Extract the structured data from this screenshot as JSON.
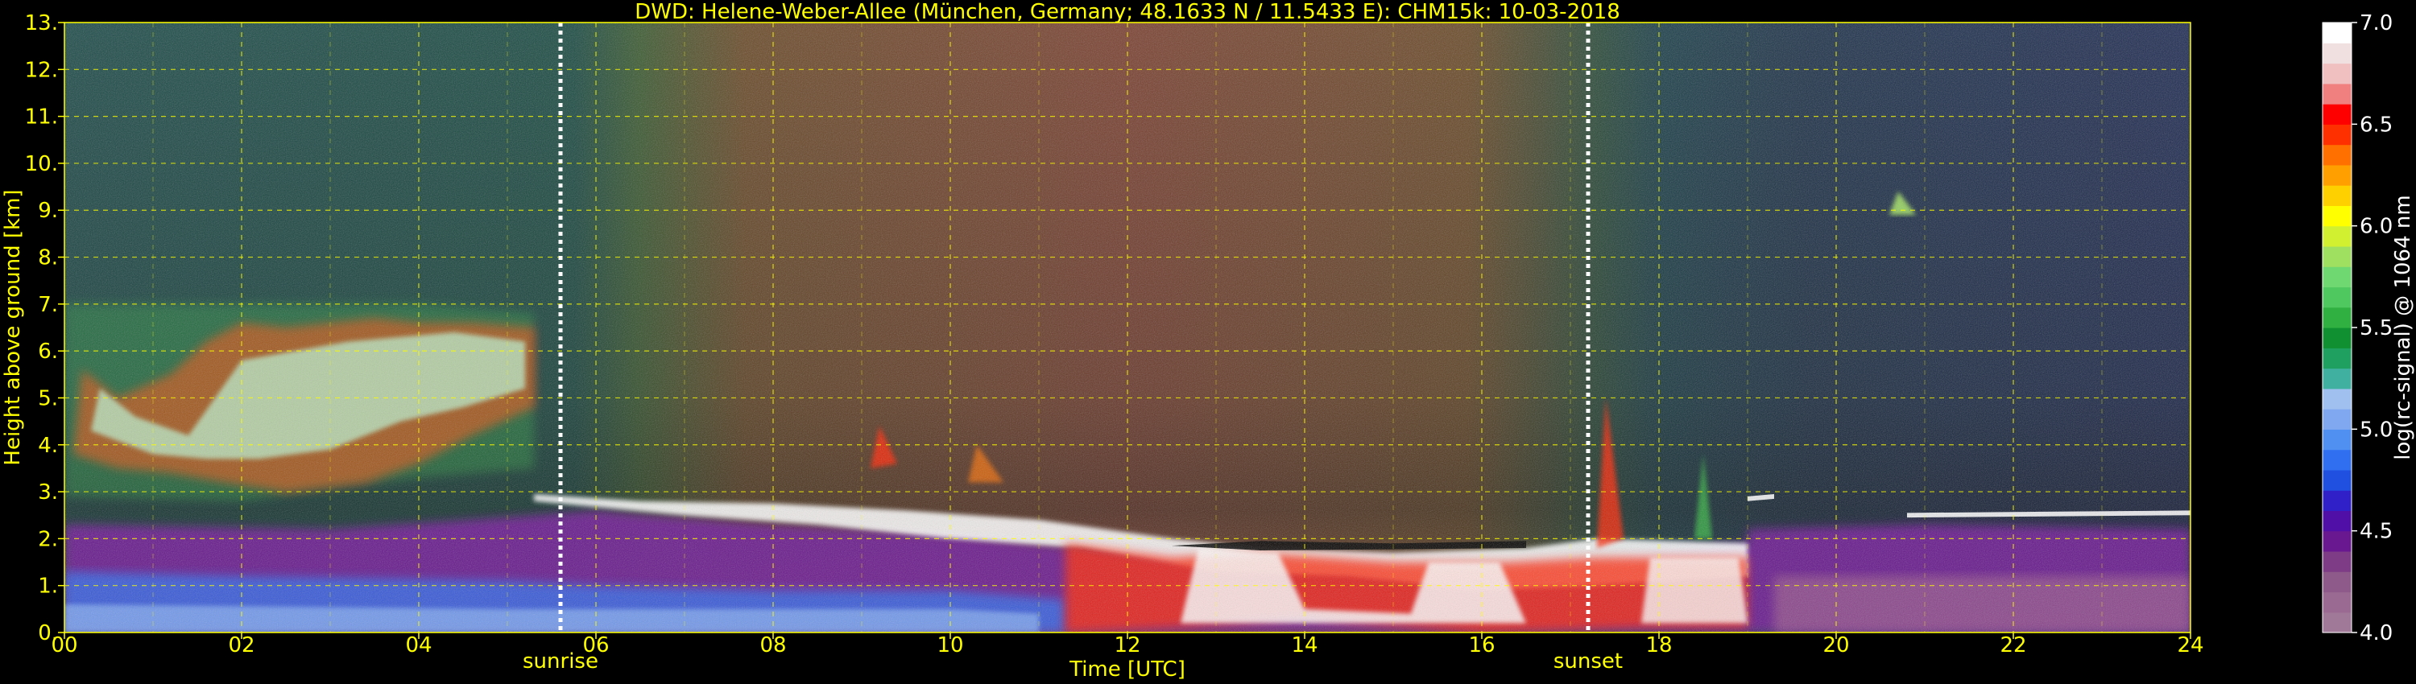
{
  "chart_data": {
    "type": "heatmap",
    "title": "DWD: Helene-Weber-Allee (München, Germany; 48.1633 N / 11.5433 E):    CHM15k: 10-03-2018",
    "xlabel": "Time [UTC]",
    "ylabel": "Height above ground [km]",
    "xlim": [
      0,
      24
    ],
    "ylim": [
      0,
      13
    ],
    "x_ticks": [
      "00",
      "02",
      "04",
      "06",
      "08",
      "10",
      "12",
      "14",
      "16",
      "18",
      "20",
      "22",
      "24"
    ],
    "y_ticks": [
      "0.",
      "1.",
      "2.",
      "3.",
      "4.",
      "5.",
      "6.",
      "7.",
      "8.",
      "9.",
      "10.",
      "11.",
      "12.",
      "13."
    ],
    "grid": true,
    "colorbar": {
      "label": "log(rc-signal) @ 1064 nm",
      "range": [
        4.0,
        7.0
      ],
      "ticks": [
        "4.0",
        "4.5",
        "5.0",
        "5.5",
        "6.0",
        "6.5",
        "7.0"
      ],
      "colors": [
        "#a07898",
        "#9a6a92",
        "#8e5a8a",
        "#7e3c86",
        "#6a1890",
        "#5010a8",
        "#3020c8",
        "#2050e0",
        "#3070f0",
        "#5090f0",
        "#80a8f0",
        "#a0c0f0",
        "#40b0a0",
        "#20a060",
        "#109030",
        "#30b040",
        "#50c860",
        "#70d870",
        "#a0e060",
        "#d0f030",
        "#ffff00",
        "#ffd000",
        "#ffa000",
        "#ff7000",
        "#ff3000",
        "#ff0000",
        "#f08080",
        "#f0c0c0",
        "#f0e0e0",
        "#ffffff"
      ]
    },
    "markers": [
      {
        "label": "sunrise",
        "time": 5.6
      },
      {
        "label": "sunset",
        "time": 17.2
      }
    ]
  }
}
